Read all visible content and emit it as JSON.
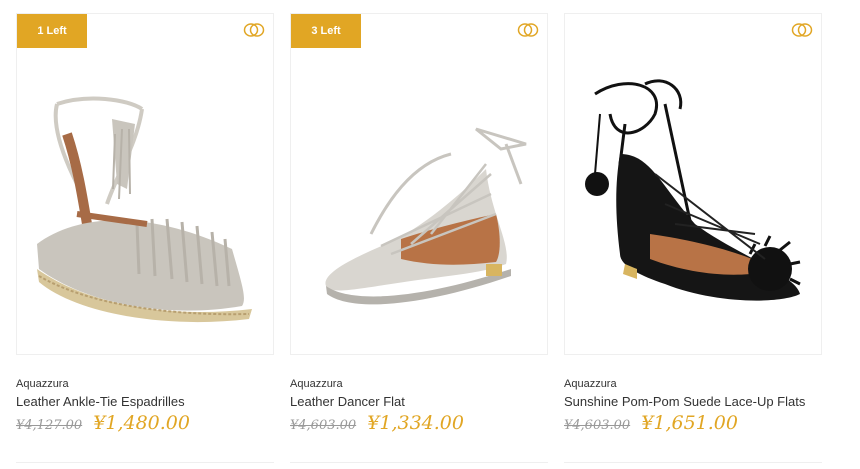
{
  "colors": {
    "accent": "#e1a624",
    "old_price": "#999999",
    "text": "#333333"
  },
  "products": [
    {
      "badge": "1 Left",
      "brand": "Aquazzura",
      "name": "Leather Ankle-Tie Espadrilles",
      "old_price": "¥4,127.00",
      "price": "¥1,480.00",
      "icon": "compare-rings-icon"
    },
    {
      "badge": "3 Left",
      "brand": "Aquazzura",
      "name": "Leather Dancer Flat",
      "old_price": "¥4,603.00",
      "price": "¥1,334.00",
      "icon": "compare-rings-icon"
    },
    {
      "badge": "",
      "brand": "Aquazzura",
      "name": "Sunshine Pom-Pom Suede Lace-Up Flats",
      "old_price": "¥4,603.00",
      "price": "¥1,651.00",
      "icon": "compare-rings-icon"
    }
  ]
}
